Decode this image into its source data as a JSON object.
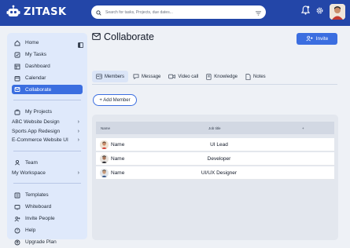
{
  "app": {
    "name": "ZITASK"
  },
  "header": {
    "search_placeholder": "Search for tasks, Projects, due dates..."
  },
  "sidebar": {
    "main_items": [
      {
        "label": "Home",
        "icon": "home-icon"
      },
      {
        "label": "My Tasks",
        "icon": "checklist-icon"
      },
      {
        "label": "Dashboard",
        "icon": "dashboard-icon"
      },
      {
        "label": "Calendar",
        "icon": "calendar-icon"
      },
      {
        "label": "Collaborate",
        "icon": "collaborate-icon",
        "active": true
      }
    ],
    "projects_label": "My Projects",
    "projects": [
      "ABC Website Design",
      "Sports App Redesign",
      "E-Commerce Website UI"
    ],
    "team_label": "Team",
    "workspace_label": "My Workspace",
    "bottom_items": [
      {
        "label": "Templates",
        "icon": "templates-icon"
      },
      {
        "label": "Whiteboard",
        "icon": "whiteboard-icon"
      },
      {
        "label": "Invite People",
        "icon": "invite-people-icon"
      },
      {
        "label": "Help",
        "icon": "help-icon"
      },
      {
        "label": "Upgrade Plan",
        "icon": "upgrade-icon"
      }
    ]
  },
  "main": {
    "title": "Collaborate",
    "invite_label": "Invite",
    "tabs": [
      {
        "label": "Members",
        "active": true
      },
      {
        "label": "Message"
      },
      {
        "label": "Video call"
      },
      {
        "label": "Knowledge"
      },
      {
        "label": "Notes"
      }
    ],
    "add_member_label": "+ Add Member",
    "table": {
      "headers": [
        "Name",
        "Job title",
        "+"
      ],
      "rows": [
        {
          "name": "Name",
          "job": "UI Lead"
        },
        {
          "name": "Name",
          "job": "Developer"
        },
        {
          "name": "Name",
          "job": "UI/UX Designer"
        }
      ]
    }
  },
  "colors": {
    "header": "#2346a8",
    "accent": "#3b6ee0",
    "sidebar": "#dfe9fb"
  }
}
